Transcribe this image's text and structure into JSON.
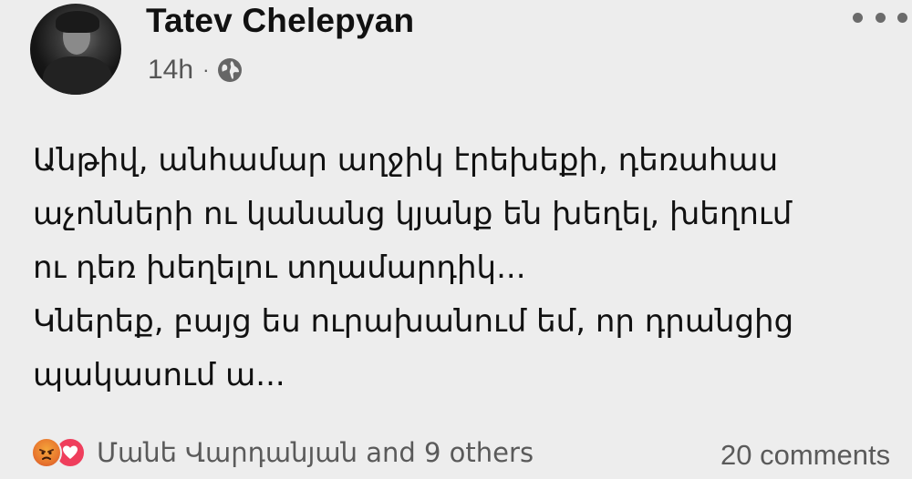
{
  "post": {
    "author": "Tatev Chelepyan",
    "time": "14h",
    "separator": "·",
    "audience_icon": "globe-icon",
    "more_icon": "more-options-icon",
    "text_lines": [
      "Անթիվ, անհամար աղջիկ էրեխեքի, դեռահաս",
      "աչոնների ու կանանց կյանք են խեղել, խեղում",
      "ու դեռ խեղելու տղամարդիկ...",
      "Կներեք, բայց ես ուրախանում եմ, որ դրանցից",
      "պակասում ա..."
    ]
  },
  "footer": {
    "reaction_icons": [
      "angry-icon",
      "love-icon"
    ],
    "reactors": "Մանե Վարդանյան and 9 others",
    "comments": "20 comments"
  },
  "colors": {
    "background": "#ededed",
    "text": "#111111",
    "secondary": "#5a5a5a",
    "angry": "#e8772e",
    "love": "#ef3e5c"
  }
}
